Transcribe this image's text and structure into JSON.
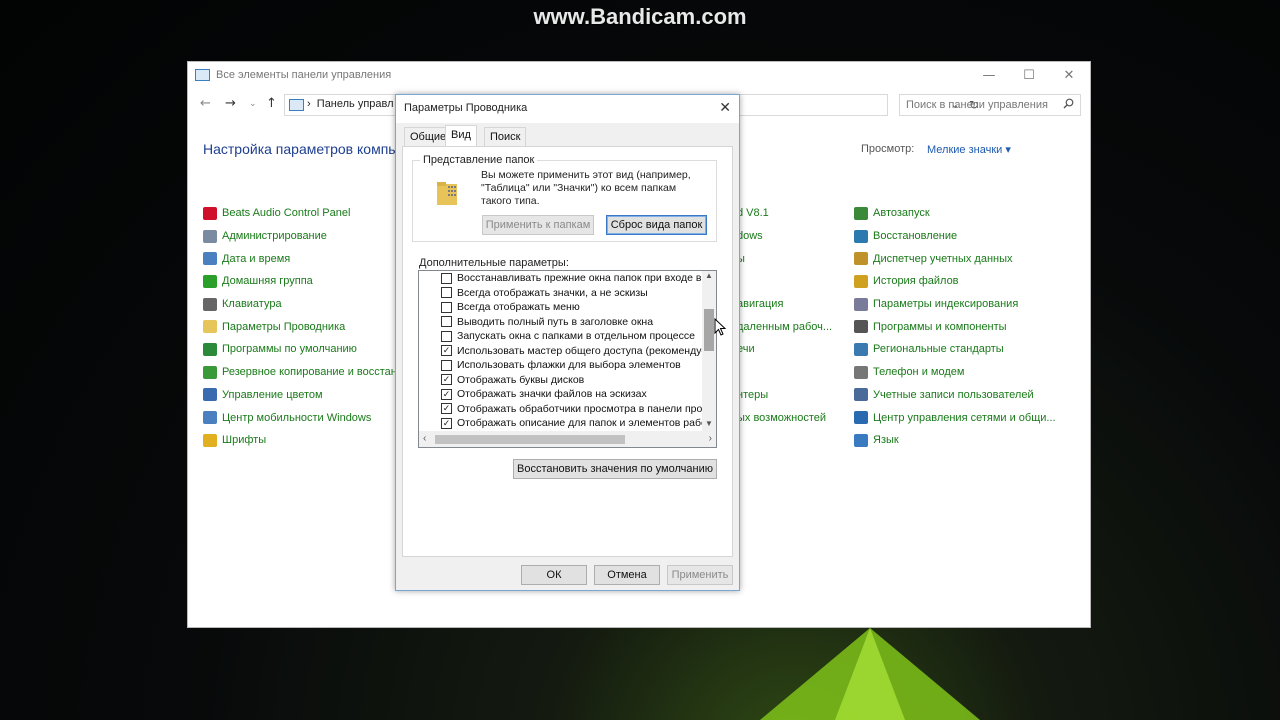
{
  "watermark": "www.Bandicam.com",
  "control_panel": {
    "title": "Все элементы панели управления",
    "address": "Панель управл",
    "search_placeholder": "Поиск в панели управления",
    "heading": "Настройка параметров компь",
    "view_label": "Просмотр:",
    "view_value": "Мелкие значки ▾",
    "columns": [
      [
        {
          "label": "Beats Audio Control Panel",
          "icon": "beats-icon",
          "color": "#d0102a"
        },
        {
          "label": "Администрирование",
          "icon": "admin-tools-icon",
          "color": "#7a8aa0"
        },
        {
          "label": "Дата и время",
          "icon": "clock-icon",
          "color": "#4a7fc0"
        },
        {
          "label": "Домашняя группа",
          "icon": "homegroup-icon",
          "color": "#2aa02a"
        },
        {
          "label": "Клавиатура",
          "icon": "keyboard-icon",
          "color": "#666666"
        },
        {
          "label": "Параметры Проводника",
          "icon": "folder-options-icon",
          "color": "#e6c55a"
        },
        {
          "label": "Программы по умолчанию",
          "icon": "default-programs-icon",
          "color": "#2a8a3a"
        },
        {
          "label": "Резервное копирование и восстан...",
          "icon": "backup-icon",
          "color": "#3a9a3a"
        },
        {
          "label": "Управление цветом",
          "icon": "color-management-icon",
          "color": "#3a6ab0"
        },
        {
          "label": "Центр мобильности Windows",
          "icon": "mobility-center-icon",
          "color": "#4a7fc0"
        },
        {
          "label": "Шрифты",
          "icon": "fonts-icon",
          "color": "#e0b020"
        }
      ],
      [
        {
          "label": "d V8.1",
          "icon": "",
          "color": ""
        },
        {
          "label": "dows",
          "icon": "",
          "color": ""
        },
        {
          "label": "ы",
          "icon": "",
          "color": ""
        },
        {
          "label": "",
          "icon": "",
          "color": ""
        },
        {
          "label": "авигация",
          "icon": "",
          "color": ""
        },
        {
          "label": "даленным рабоч...",
          "icon": "",
          "color": ""
        },
        {
          "label": "ечи",
          "icon": "",
          "color": ""
        },
        {
          "label": "",
          "icon": "",
          "color": ""
        },
        {
          "label": "нтеры",
          "icon": "",
          "color": ""
        },
        {
          "label": "ых возможностей",
          "icon": "",
          "color": ""
        }
      ],
      [
        {
          "label": "Автозапуск",
          "icon": "autoplay-icon",
          "color": "#3a8a3a"
        },
        {
          "label": "Восстановление",
          "icon": "recovery-icon",
          "color": "#2a7ab0"
        },
        {
          "label": "Диспетчер учетных данных",
          "icon": "credential-manager-icon",
          "color": "#c0902a"
        },
        {
          "label": "История файлов",
          "icon": "file-history-icon",
          "color": "#d0a020"
        },
        {
          "label": "Параметры индексирования",
          "icon": "indexing-icon",
          "color": "#7a7a9a"
        },
        {
          "label": "Программы и компоненты",
          "icon": "programs-icon",
          "color": "#555555"
        },
        {
          "label": "Региональные стандарты",
          "icon": "region-icon",
          "color": "#3a7ab0"
        },
        {
          "label": "Телефон и модем",
          "icon": "phone-modem-icon",
          "color": "#777777"
        },
        {
          "label": "Учетные записи пользователей",
          "icon": "user-accounts-icon",
          "color": "#4a6a9a"
        },
        {
          "label": "Центр управления сетями и общи...",
          "icon": "network-center-icon",
          "color": "#2a6ab0"
        },
        {
          "label": "Язык",
          "icon": "language-icon",
          "color": "#3a7ac0"
        }
      ]
    ]
  },
  "dialog": {
    "title": "Параметры Проводника",
    "tabs": [
      "Общие",
      "Вид",
      "Поиск"
    ],
    "active_tab": "Вид",
    "folder_views": {
      "legend": "Представление папок",
      "description": "Вы можете применить этот вид (например, \"Таблица\" или \"Значки\") ко всем папкам такого типа.",
      "apply_button": "Применить к папкам",
      "reset_button": "Сброс вида папок"
    },
    "advanced_label": "Дополнительные параметры:",
    "advanced_items": [
      {
        "label": "Восстанавливать прежние окна папок при входе в си",
        "checked": false
      },
      {
        "label": "Всегда отображать значки, а не эскизы",
        "checked": false
      },
      {
        "label": "Всегда отображать меню",
        "checked": false
      },
      {
        "label": "Выводить полный путь в заголовке окна",
        "checked": false
      },
      {
        "label": "Запускать окна с папками в отдельном процессе",
        "checked": false
      },
      {
        "label": "Использовать мастер общего доступа (рекомендует",
        "checked": true
      },
      {
        "label": "Использовать флажки для выбора элементов",
        "checked": false
      },
      {
        "label": "Отображать буквы дисков",
        "checked": true
      },
      {
        "label": "Отображать значки файлов на эскизах",
        "checked": true
      },
      {
        "label": "Отображать обработчики просмотра в панели просм",
        "checked": true
      },
      {
        "label": "Отображать описание для папок и элементов рабоче",
        "checked": true
      }
    ],
    "restore_defaults_button": "Восстановить значения по умолчанию",
    "ok_button": "ОК",
    "cancel_button": "Отмена",
    "apply_button": "Применить"
  }
}
